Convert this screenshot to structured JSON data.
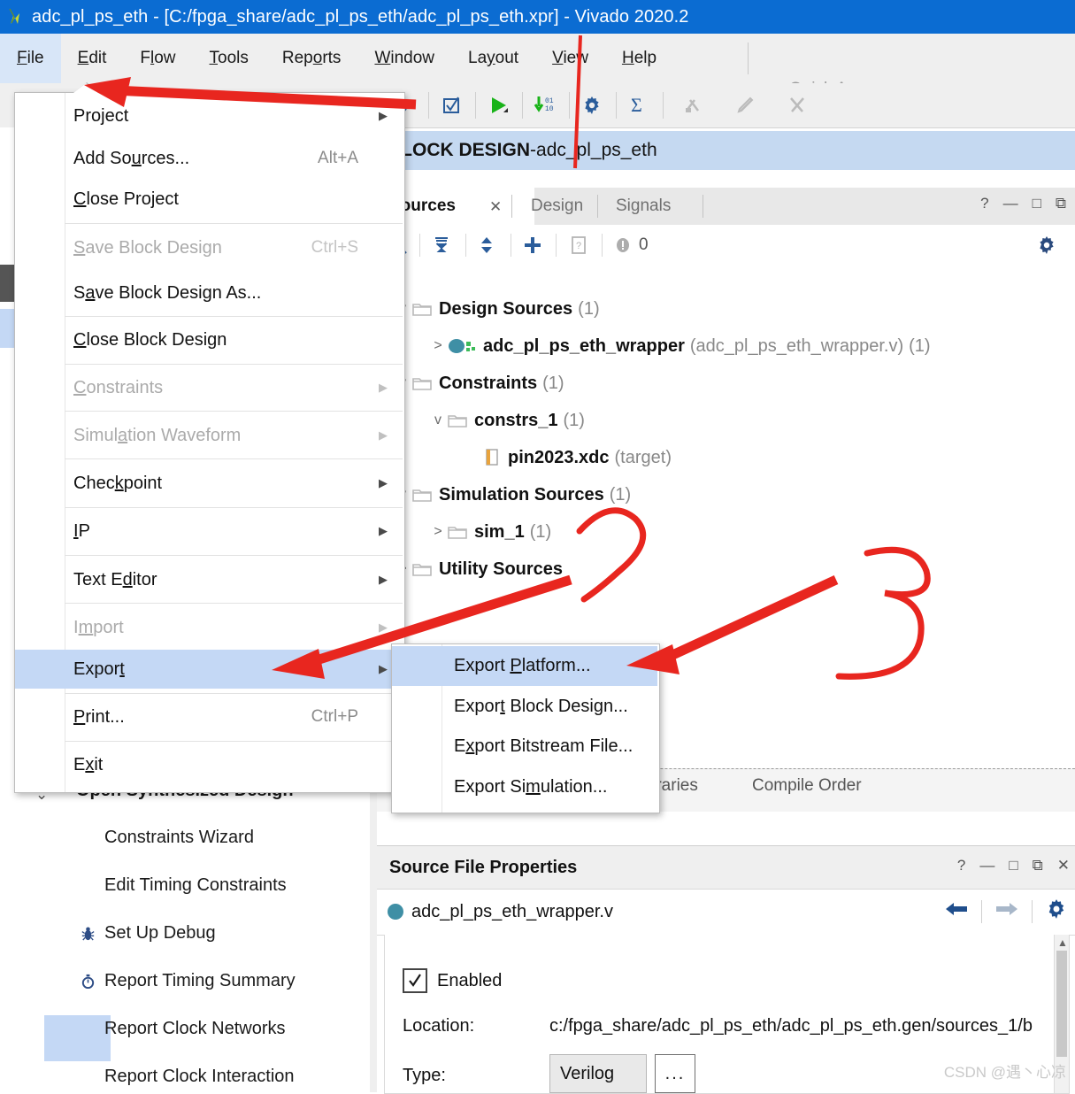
{
  "window": {
    "title": "adc_pl_ps_eth - [C:/fpga_share/adc_pl_ps_eth/adc_pl_ps_eth.xpr] - Vivado 2020.2",
    "logo_icon": "vivado-logo-icon"
  },
  "menubar": {
    "items": [
      {
        "label": "File",
        "mnemonic": "F",
        "active": true
      },
      {
        "label": "Edit",
        "mnemonic": "E",
        "active": false
      },
      {
        "label": "Flow",
        "mnemonic": "l",
        "active": false
      },
      {
        "label": "Tools",
        "mnemonic": "T",
        "active": false
      },
      {
        "label": "Reports",
        "mnemonic": "o",
        "active": false
      },
      {
        "label": "Window",
        "mnemonic": "W",
        "active": false
      },
      {
        "label": "Layout",
        "mnemonic": "y",
        "active": false
      },
      {
        "label": "View",
        "mnemonic": "V",
        "active": false
      },
      {
        "label": "Help",
        "mnemonic": "H",
        "active": false
      }
    ]
  },
  "quick_access": {
    "placeholder": "Quick Access",
    "icon": "search-icon",
    "value": ""
  },
  "toolbar": {
    "buttons": [
      {
        "name": "open-icon",
        "glyph": "open",
        "enabled": true
      },
      {
        "name": "validate-design-icon",
        "glyph": "checkbox",
        "enabled": true
      },
      {
        "name": "run-icon",
        "glyph": "play",
        "enabled": true
      },
      {
        "name": "download-bitstream-icon",
        "glyph": "download",
        "enabled": true
      },
      {
        "name": "settings-gear-icon",
        "glyph": "gear",
        "enabled": true
      },
      {
        "name": "sigma-icon",
        "glyph": "sigma",
        "enabled": true
      },
      {
        "name": "marker-icon",
        "glyph": "marker",
        "enabled": false
      },
      {
        "name": "pencil-icon",
        "glyph": "pencil",
        "enabled": false
      },
      {
        "name": "scissors-icon",
        "glyph": "scissors",
        "enabled": false
      }
    ]
  },
  "file_menu": {
    "items": [
      {
        "label": "Project",
        "mnemonic": "j",
        "accel": "",
        "submenu": true,
        "disabled": false,
        "highlight": false
      },
      {
        "label": "Add Sources...",
        "mnemonic": "u",
        "accel": "Alt+A",
        "submenu": false,
        "disabled": false,
        "highlight": false
      },
      {
        "label": "Close Project",
        "mnemonic": "C",
        "accel": "",
        "submenu": false,
        "disabled": false,
        "highlight": false
      },
      {
        "label": "Save Block Design",
        "mnemonic": "S",
        "accel": "Ctrl+S",
        "submenu": false,
        "disabled": true,
        "highlight": false
      },
      {
        "label": "Save Block Design As...",
        "mnemonic": "a",
        "accel": "",
        "submenu": false,
        "disabled": false,
        "highlight": false
      },
      {
        "label": "Close Block Design",
        "mnemonic": "C",
        "accel": "",
        "submenu": false,
        "disabled": false,
        "highlight": false
      },
      {
        "label": "Constraints",
        "mnemonic": "C",
        "accel": "",
        "submenu": true,
        "disabled": true,
        "highlight": false
      },
      {
        "label": "Simulation Waveform",
        "mnemonic": "a",
        "accel": "",
        "submenu": true,
        "disabled": true,
        "highlight": false
      },
      {
        "label": "Checkpoint",
        "mnemonic": "k",
        "accel": "",
        "submenu": true,
        "disabled": false,
        "highlight": false
      },
      {
        "label": "IP",
        "mnemonic": "I",
        "accel": "",
        "submenu": true,
        "disabled": false,
        "highlight": false
      },
      {
        "label": "Text Editor",
        "mnemonic": "d",
        "accel": "",
        "submenu": true,
        "disabled": false,
        "highlight": false
      },
      {
        "label": "Import",
        "mnemonic": "m",
        "accel": "",
        "submenu": true,
        "disabled": true,
        "highlight": false
      },
      {
        "label": "Export",
        "mnemonic": "t",
        "accel": "",
        "submenu": true,
        "disabled": false,
        "highlight": true
      },
      {
        "label": "Print...",
        "mnemonic": "P",
        "accel": "Ctrl+P",
        "submenu": false,
        "disabled": false,
        "highlight": false
      },
      {
        "label": "Exit",
        "mnemonic": "x",
        "accel": "",
        "submenu": false,
        "disabled": false,
        "highlight": false
      }
    ]
  },
  "export_menu": {
    "items": [
      {
        "label": "Export Platform...",
        "mnemonic": "p",
        "highlight": true
      },
      {
        "label": "Export Block Design...",
        "mnemonic": "t",
        "highlight": false
      },
      {
        "label": "Export Bitstream File...",
        "mnemonic": "x",
        "highlight": false
      },
      {
        "label": "Export Simulation...",
        "mnemonic": "m",
        "highlight": false
      }
    ]
  },
  "flow_navigator": {
    "items": [
      {
        "label": "Open Synthesized Design",
        "icon": "",
        "bold": true,
        "chevron": "v",
        "indent": 60
      },
      {
        "label": "Constraints Wizard",
        "icon": "",
        "bold": false,
        "chevron": "",
        "indent": 118
      },
      {
        "label": "Edit Timing Constraints",
        "icon": "",
        "bold": false,
        "chevron": "",
        "indent": 118
      },
      {
        "label": "Set Up Debug",
        "icon": "bug-icon",
        "bold": false,
        "chevron": "",
        "indent": 88
      },
      {
        "label": "Report Timing Summary",
        "icon": "stopwatch-icon",
        "bold": false,
        "chevron": "",
        "indent": 88
      },
      {
        "label": "Report Clock Networks",
        "icon": "",
        "bold": false,
        "chevron": "",
        "indent": 118
      },
      {
        "label": "Report Clock Interaction",
        "icon": "",
        "bold": false,
        "chevron": "",
        "indent": 118
      }
    ]
  },
  "block_design_banner": {
    "prefix": "BLOCK DESIGN",
    "separator": " - ",
    "name": "adc_pl_ps_eth"
  },
  "sources_panel": {
    "tabs": [
      {
        "label": "Sources",
        "selected": true,
        "closable": true
      },
      {
        "label": "Design",
        "selected": false,
        "closable": false
      },
      {
        "label": "Signals",
        "selected": false,
        "closable": false
      }
    ],
    "window_buttons": [
      "?",
      "—",
      "□",
      "⧉"
    ],
    "toolbar": {
      "search_icon": "search-icon",
      "collapse_icon": "collapse-all-icon",
      "expand_icon": "expand-all-icon",
      "add_icon": "plus-icon",
      "report_icon": "report-icon",
      "message_icon": "message-icon",
      "message_count": "0",
      "settings_icon": "gear-icon"
    },
    "tree": [
      {
        "label": "Design Sources",
        "count": "(1)",
        "indent": 18,
        "twisty": "v",
        "icon": "folder-icon",
        "bold": true,
        "extra": ""
      },
      {
        "label": "adc_pl_ps_eth_wrapper",
        "count": "(1)",
        "indent": 58,
        "twisty": ">",
        "icon": "module-icon",
        "bold": true,
        "extra": "(adc_pl_ps_eth_wrapper.v)"
      },
      {
        "label": "Constraints",
        "count": "(1)",
        "indent": 18,
        "twisty": "v",
        "icon": "folder-icon",
        "bold": true,
        "extra": ""
      },
      {
        "label": "constrs_1",
        "count": "(1)",
        "indent": 58,
        "twisty": "v",
        "icon": "folder-icon",
        "bold": true,
        "extra": ""
      },
      {
        "label": "pin2023.xdc",
        "count": "",
        "indent": 100,
        "twisty": "",
        "icon": "xdc-file-icon",
        "bold": true,
        "extra": "(target)"
      },
      {
        "label": "Simulation Sources",
        "count": "(1)",
        "indent": 18,
        "twisty": "v",
        "icon": "folder-icon",
        "bold": true,
        "extra": ""
      },
      {
        "label": "sim_1",
        "count": "(1)",
        "indent": 58,
        "twisty": ">",
        "icon": "folder-icon",
        "bold": true,
        "extra": ""
      },
      {
        "label": "Utility Sources",
        "count": "",
        "indent": 18,
        "twisty": ">",
        "icon": "folder-icon",
        "bold": true,
        "extra": ""
      }
    ],
    "bottom_tabs": [
      {
        "label": "Libraries"
      },
      {
        "label": "Compile Order"
      }
    ]
  },
  "source_file_properties": {
    "title": "Source File Properties",
    "window_buttons": [
      "?",
      "—",
      "□",
      "⧉",
      "✕"
    ],
    "file_name": "adc_pl_ps_eth_wrapper.v",
    "nav_buttons": [
      "back-arrow-icon",
      "forward-arrow-icon",
      "gear-icon"
    ],
    "enabled_label": "Enabled",
    "enabled_checked": true,
    "location_label": "Location:",
    "location_value": "c:/fpga_share/adc_pl_ps_eth/adc_pl_ps_eth.gen/sources_1/b",
    "type_label": "Type:",
    "type_value": "Verilog",
    "browse_label": "..."
  },
  "annotations": {
    "accent_color": "#e8261f",
    "marks": [
      {
        "kind": "arrow",
        "note": "arrow pointing to File menu"
      },
      {
        "kind": "line",
        "note": "vertical stroke near Layout"
      },
      {
        "kind": "arrow",
        "note": "arrow pointing to Export item"
      },
      {
        "kind": "arrow",
        "note": "arrow pointing to Export Platform item"
      },
      {
        "kind": "digit",
        "label": "2"
      },
      {
        "kind": "digit",
        "label": "3"
      }
    ]
  },
  "watermark": {
    "text": "CSDN @遇丶心凉"
  }
}
